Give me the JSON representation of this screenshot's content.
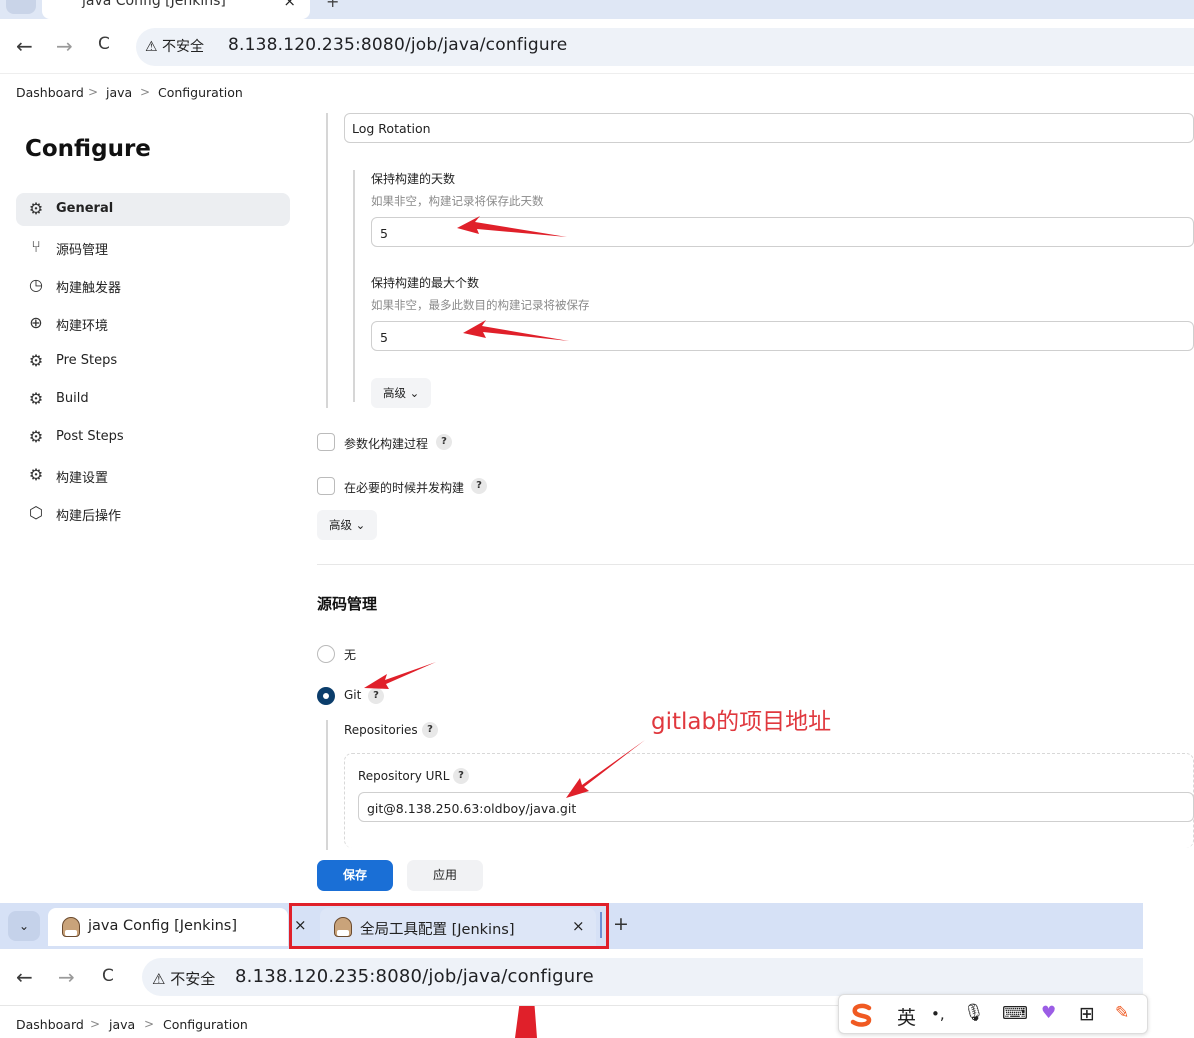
{
  "top_browser": {
    "tab_title": "java Config [Jenkins]",
    "close_glyph": "×",
    "new_tab_glyph": "+",
    "back": "←",
    "forward": "→",
    "reload": "C",
    "security_label": "⚠ 不安全",
    "url": "8.138.120.235:8080/job/java/configure"
  },
  "breadcrumb": [
    "Dashboard",
    "java",
    "Configuration"
  ],
  "breadcrumb_sep": ">",
  "page_title": "Configure",
  "sidebar": {
    "items": [
      {
        "label": "General",
        "icon": "gear-icon",
        "glyph": "⚙"
      },
      {
        "label": "源码管理",
        "icon": "branch-icon",
        "glyph": "⑂"
      },
      {
        "label": "构建触发器",
        "icon": "clock-icon",
        "glyph": "◷"
      },
      {
        "label": "构建环境",
        "icon": "globe-icon",
        "glyph": "⊕"
      },
      {
        "label": "Pre Steps",
        "icon": "gear-icon",
        "glyph": "⚙"
      },
      {
        "label": "Build",
        "icon": "gear-icon",
        "glyph": "⚙"
      },
      {
        "label": "Post Steps",
        "icon": "gear-icon",
        "glyph": "⚙"
      },
      {
        "label": "构建设置",
        "icon": "gear-icon",
        "glyph": "⚙"
      },
      {
        "label": "构建后操作",
        "icon": "cube-icon",
        "glyph": "⬡"
      }
    ]
  },
  "log_rotation": {
    "strategy": "Log Rotation",
    "days_label": "保持构建的天数",
    "days_hint": "如果非空，构建记录将保存此天数",
    "days_value": "5",
    "max_label": "保持构建的最大个数",
    "max_hint": "如果非空，最多此数目的构建记录将被保存",
    "max_value": "5",
    "advanced": "高级 ⌄"
  },
  "options": {
    "parameterized": "参数化构建过程",
    "concurrent": "在必要的时候并发构建",
    "advanced": "高级 ⌄",
    "help": "?"
  },
  "scm": {
    "title": "源码管理",
    "none_label": "无",
    "git_label": "Git",
    "repositories_label": "Repositories",
    "repo_url_label": "Repository URL",
    "repo_url_value": "git@8.138.250.63:oldboy/java.git",
    "annotation": "gitlab的项目地址"
  },
  "buttons": {
    "save": "保存",
    "apply": "应用"
  },
  "bottom_browser": {
    "dropdown": "⌄",
    "tabs": [
      {
        "title": "java Config [Jenkins]",
        "close": "×"
      },
      {
        "title": "全局工具配置 [Jenkins]",
        "close": "×"
      }
    ],
    "new_tab": "+",
    "back": "←",
    "forward": "→",
    "reload": "C",
    "security_label": "⚠ 不安全",
    "url": "8.138.120.235:8080/job/java/configure",
    "breadcrumb": [
      "Dashboard",
      "java",
      "Configuration"
    ]
  },
  "ime_toolbar": [
    "英",
    "•,",
    "🎙",
    "⌨",
    "♥",
    "⊞",
    "✎"
  ],
  "colors": {
    "annotation_red": "#e0383e",
    "primary_button": "#1a6fd6",
    "radio_on": "#0b3d6b"
  }
}
